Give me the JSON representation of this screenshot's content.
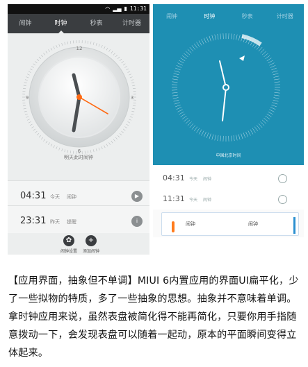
{
  "left_phone": {
    "status_time": "11:31",
    "tabs": [
      {
        "label": "闹钟"
      },
      {
        "label": "时钟"
      },
      {
        "label": "秒表"
      },
      {
        "label": "计时器"
      }
    ],
    "dial_numbers": [
      "12",
      "3",
      "6",
      "9"
    ],
    "clock_caption": "明天此时闹钟",
    "alarms": [
      {
        "time": "04:31",
        "day": "今天",
        "label": "闹钟",
        "toggle": "▶"
      },
      {
        "time": "23:31",
        "day": "昨天",
        "label": "提醒",
        "toggle": "i"
      }
    ],
    "buttons": [
      {
        "icon": "✿",
        "label": "闹钟设置"
      },
      {
        "icon": "+",
        "label": "添加闹钟"
      }
    ]
  },
  "right_phone": {
    "tabs": [
      {
        "label": "闹钟"
      },
      {
        "label": "时钟"
      },
      {
        "label": "秒表"
      },
      {
        "label": "计时器"
      }
    ],
    "clock_caption": "中国北京时间",
    "alarms": [
      {
        "time": "04:31",
        "day": "今天",
        "label": "闹钟"
      },
      {
        "time": "11:31",
        "day": "今天",
        "label": "闹钟"
      }
    ],
    "partial": {
      "text_left": "闹钟",
      "text_right": "闹钟"
    }
  },
  "caption_text": "【应用界面，抽象但不单调】MIUI 6内置应用的界面UI扁平化，少了一些拟物的特质，多了一些抽象的思想。抽象并不意味着单调。拿时钟应用来说，虽然表盘被简化得不能再简化，只要你用手指随意拨动一下，会发现表盘可以随着一起动，原本的平面瞬间变得立体起来。",
  "colors": {
    "accent_orange": "#ff6a13",
    "flat_blue": "#1e8fb3",
    "dark_tab": "#3a3d40"
  }
}
